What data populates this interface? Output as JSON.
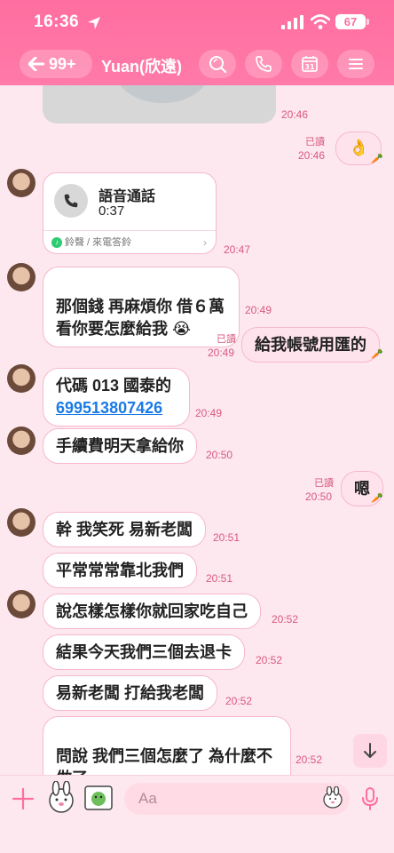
{
  "status_bar": {
    "time": "16:36",
    "battery": "67"
  },
  "nav": {
    "back_count": "99+",
    "title": "Yuan(欣遠)"
  },
  "messages": {
    "m0_time": "20:46",
    "m1": {
      "read": "已讀",
      "time": "20:46",
      "text": "👌"
    },
    "call": {
      "title": "語音通話",
      "duration": "0:37",
      "footer": "鈴聲 / 來電答鈴",
      "time": "20:47"
    },
    "m3": {
      "text": "那個錢 再麻煩你 借６萬\n看你要怎麼給我 😭",
      "time": "20:49"
    },
    "m4": {
      "read": "已讀",
      "time": "20:49",
      "text": "給我帳號用匯的"
    },
    "m5": {
      "text": "代碼 013 國泰的",
      "link": "699513807426",
      "time": "20:49"
    },
    "m6": {
      "text": "手續費明天拿給你",
      "time": "20:50"
    },
    "m7": {
      "read": "已讀",
      "time": "20:50",
      "text": "嗯"
    },
    "m8": {
      "text": "幹 我笑死 易新老闆",
      "time": "20:51"
    },
    "m9": {
      "text": "平常常常靠北我們",
      "time": "20:51"
    },
    "m10": {
      "text": "說怎樣怎樣你就回家吃自己",
      "time": "20:52"
    },
    "m11": {
      "text": "結果今天我們三個去退卡",
      "time": "20:52"
    },
    "m12": {
      "text": "易新老闆 打給我老闆",
      "time": "20:52"
    },
    "m13": {
      "text": "問說 我們三個怎麼了 為什麼不\n做了",
      "time": "20:52"
    }
  },
  "input": {
    "placeholder": "Aa"
  },
  "colors": {
    "header": "#ff6ea0",
    "background": "#fde8f0",
    "bubble_border": "#f6b8cc",
    "timestamp": "#d9597f"
  }
}
